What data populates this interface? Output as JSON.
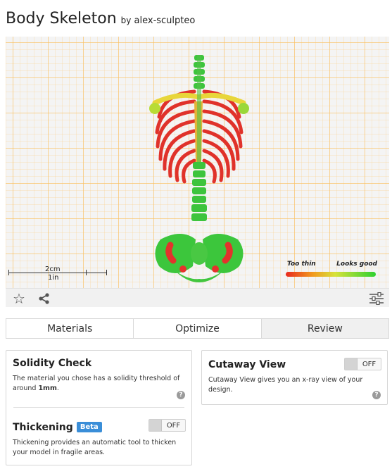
{
  "header": {
    "title": "Body Skeleton",
    "by": "by",
    "author": "alex-sculpteo"
  },
  "viewer": {
    "scale_metric": "2cm",
    "scale_imperial": "1in",
    "legend_low": "Too thin",
    "legend_high": "Looks good",
    "colors": {
      "grid": "#fbbd5c",
      "thin": "#e8291e",
      "good": "#2ed12f"
    }
  },
  "toolbar": {
    "icons": [
      "star-icon",
      "share-icon",
      "settings-sliders-icon"
    ]
  },
  "tabs": [
    {
      "label": "Materials",
      "active": false
    },
    {
      "label": "Optimize",
      "active": false
    },
    {
      "label": "Review",
      "active": true
    }
  ],
  "solidity": {
    "title": "Solidity Check",
    "desc_before": "The material you chose has a solidity threshold of around ",
    "desc_value": "1mm",
    "desc_after": ".",
    "help": "?"
  },
  "thickening": {
    "title": "Thickening",
    "badge": "Beta",
    "toggle": "OFF",
    "desc": "Thickening provides an automatic tool to thicken your model in fragile areas."
  },
  "cutaway": {
    "title": "Cutaway View",
    "toggle": "OFF",
    "desc": "Cutaway View gives you an x-ray view of your design.",
    "help": "?"
  }
}
